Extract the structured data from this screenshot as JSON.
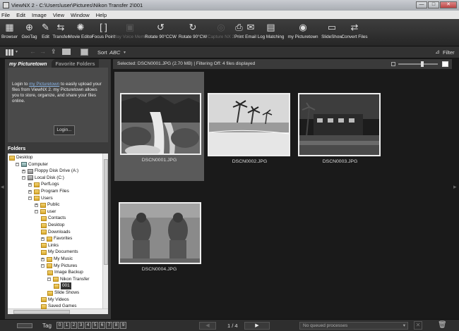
{
  "window": {
    "title": "ViewNX 2 - C:\\Users\\user\\Pictures\\Nikon Transfer 2\\001",
    "min": "—",
    "max": "□",
    "close": "✕"
  },
  "menu": [
    "File",
    "Edit",
    "Image",
    "View",
    "Window",
    "Help"
  ],
  "toolbar": [
    {
      "label": "Browser",
      "icon": "browser-icon",
      "glyph": "▦",
      "enabled": true
    },
    {
      "label": "GeoTag",
      "icon": "geotag-icon",
      "glyph": "⊕",
      "enabled": true
    },
    {
      "label": "Edit",
      "icon": "edit-icon",
      "glyph": "✎",
      "enabled": true
    },
    {
      "label": "Transfer",
      "icon": "transfer-icon",
      "glyph": "⇆",
      "enabled": true
    },
    {
      "label": "Movie Editor",
      "icon": "movie-editor-icon",
      "glyph": "✺",
      "enabled": true
    },
    {
      "label": "Focus Point",
      "icon": "focus-point-icon",
      "glyph": "[ ]",
      "enabled": true
    },
    {
      "label": "Play Voice Memo",
      "icon": "voice-memo-icon",
      "glyph": "▣",
      "enabled": false
    },
    {
      "label": "Rotate 90°CCW",
      "icon": "rotate-ccw-icon",
      "glyph": "↺",
      "enabled": true
    },
    {
      "label": "Rotate 90°CW",
      "icon": "rotate-cw-icon",
      "glyph": "↻",
      "enabled": true
    },
    {
      "label": "Capture NX 2",
      "icon": "capture-nx-icon",
      "glyph": "◎",
      "enabled": false
    },
    {
      "label": "Print",
      "icon": "print-icon",
      "glyph": "⎙",
      "enabled": true
    },
    {
      "label": "Email",
      "icon": "email-icon",
      "glyph": "✉",
      "enabled": true
    },
    {
      "label": "Log Matching",
      "icon": "log-matching-icon",
      "glyph": "▤",
      "enabled": true
    },
    {
      "label": "my Picturetown",
      "icon": "picturetown-icon",
      "glyph": "◉",
      "enabled": true
    },
    {
      "label": "SlideShow",
      "icon": "slideshow-icon",
      "glyph": "▭",
      "enabled": true
    },
    {
      "label": "Convert Files",
      "icon": "convert-files-icon",
      "glyph": "⇄",
      "enabled": true
    }
  ],
  "subbar": {
    "sort_label": "Sort",
    "sort_value": "ABC",
    "filter_label": "Filter"
  },
  "left_panel": {
    "tab_active": "my Picturetown",
    "tab_inactive": "Favorite Folders",
    "login_text_pre": "Login to ",
    "login_link": "my Picturetown",
    "login_text_post": " to easily upload your files from ViewNX 2. my Picturetown allows you to store, organize, and share your files online.",
    "login_button": "Login...",
    "folders_header": "Folders",
    "tree": [
      {
        "label": "Desktop",
        "indent": 0,
        "toggle": "",
        "icon": "desktop"
      },
      {
        "label": "Computer",
        "indent": 1,
        "toggle": "−",
        "icon": "comp"
      },
      {
        "label": "Floppy Disk Drive (A:)",
        "indent": 2,
        "toggle": "+",
        "icon": "drive"
      },
      {
        "label": "Local Disk (C:)",
        "indent": 2,
        "toggle": "−",
        "icon": "drive"
      },
      {
        "label": "PerfLogs",
        "indent": 3,
        "toggle": "+",
        "icon": "folder"
      },
      {
        "label": "Program Files",
        "indent": 3,
        "toggle": "+",
        "icon": "folder"
      },
      {
        "label": "Users",
        "indent": 3,
        "toggle": "−",
        "icon": "folder"
      },
      {
        "label": "Public",
        "indent": 4,
        "toggle": "+",
        "icon": "folder"
      },
      {
        "label": "user",
        "indent": 4,
        "toggle": "−",
        "icon": "folder"
      },
      {
        "label": "Contacts",
        "indent": 5,
        "toggle": "",
        "icon": "folder"
      },
      {
        "label": "Desktop",
        "indent": 5,
        "toggle": "",
        "icon": "folder"
      },
      {
        "label": "Downloads",
        "indent": 5,
        "toggle": "",
        "icon": "folder"
      },
      {
        "label": "Favorites",
        "indent": 5,
        "toggle": "+",
        "icon": "folder"
      },
      {
        "label": "Links",
        "indent": 5,
        "toggle": "",
        "icon": "folder"
      },
      {
        "label": "My Documents",
        "indent": 5,
        "toggle": "",
        "icon": "folder"
      },
      {
        "label": "My Music",
        "indent": 5,
        "toggle": "+",
        "icon": "folder"
      },
      {
        "label": "My Pictures",
        "indent": 5,
        "toggle": "−",
        "icon": "folder"
      },
      {
        "label": "Image Backup",
        "indent": 6,
        "toggle": "",
        "icon": "folder"
      },
      {
        "label": "Nikon Transfer",
        "indent": 6,
        "toggle": "−",
        "icon": "folder"
      },
      {
        "label": "001",
        "indent": 7,
        "toggle": "",
        "icon": "folder",
        "selected": true
      },
      {
        "label": "Slide Shows",
        "indent": 6,
        "toggle": "",
        "icon": "folder"
      },
      {
        "label": "My Videos",
        "indent": 5,
        "toggle": "",
        "icon": "folder"
      },
      {
        "label": "Saved Games",
        "indent": 5,
        "toggle": "",
        "icon": "folder"
      }
    ]
  },
  "main": {
    "info": "Selected: DSCN0001.JPG (2.70 MB) | Filtering Off: 4 files displayed",
    "thumbs": [
      {
        "caption": "DSCN0001.JPG",
        "selected": true,
        "scene": "waterfall"
      },
      {
        "caption": "DSCN0002.JPG",
        "selected": false,
        "scene": "beach"
      },
      {
        "caption": "DSCN0003.JPG",
        "selected": false,
        "scene": "night"
      },
      {
        "caption": "DSCN0004.JPG",
        "selected": false,
        "scene": "statues"
      }
    ]
  },
  "status": {
    "tag_label": "Tag",
    "tags": [
      "0",
      "1",
      "2",
      "3",
      "4",
      "5",
      "6",
      "7",
      "8",
      "9"
    ],
    "page": "1 / 4",
    "queue": "No queued processes"
  }
}
